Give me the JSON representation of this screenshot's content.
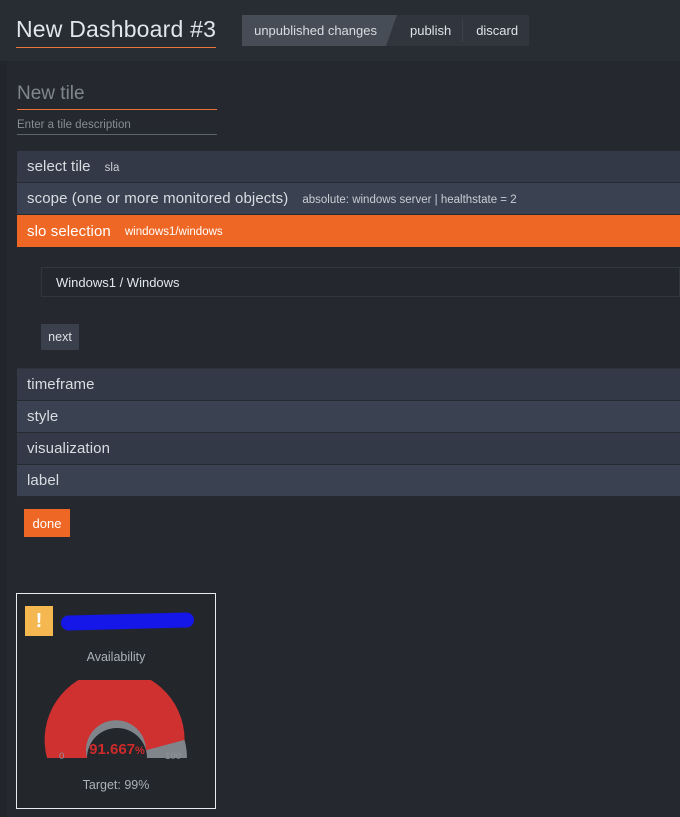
{
  "header": {
    "dashboard_title": "New Dashboard #3",
    "unpublished_label": "unpublished changes",
    "publish_label": "publish",
    "discard_label": "discard",
    "accent_color": "#ef6724"
  },
  "tile_editor": {
    "name_placeholder": "New tile",
    "description_placeholder": "Enter a tile description",
    "rows": [
      {
        "label": "select tile",
        "value": "sla",
        "active": false
      },
      {
        "label": "scope (one or more monitored objects)",
        "value": "absolute: windows server | healthstate = 2",
        "active": false
      },
      {
        "label": "slo selection",
        "value": "windows1/windows",
        "active": true
      },
      {
        "label": "timeframe",
        "value": "",
        "active": false
      },
      {
        "label": "style",
        "value": "",
        "active": false
      },
      {
        "label": "visualization",
        "value": "",
        "active": false
      },
      {
        "label": "label",
        "value": "",
        "active": false
      }
    ],
    "slo_panel": {
      "item": "Windows1 / Windows",
      "next_label": "next"
    },
    "done_label": "done"
  },
  "preview_tile": {
    "warning_glyph": "!",
    "title_redacted": "",
    "metric_label": "Availability",
    "target_label": "Target: 99%",
    "gauge": {
      "value_text": "91.667",
      "percent_suffix": "%",
      "min_label": "0",
      "max_label": "100",
      "value": 91.667,
      "min": 0,
      "max": 100,
      "fill_color": "#cf3030",
      "track_color": "#7f858b",
      "value_color": "#cf2a2a"
    }
  }
}
